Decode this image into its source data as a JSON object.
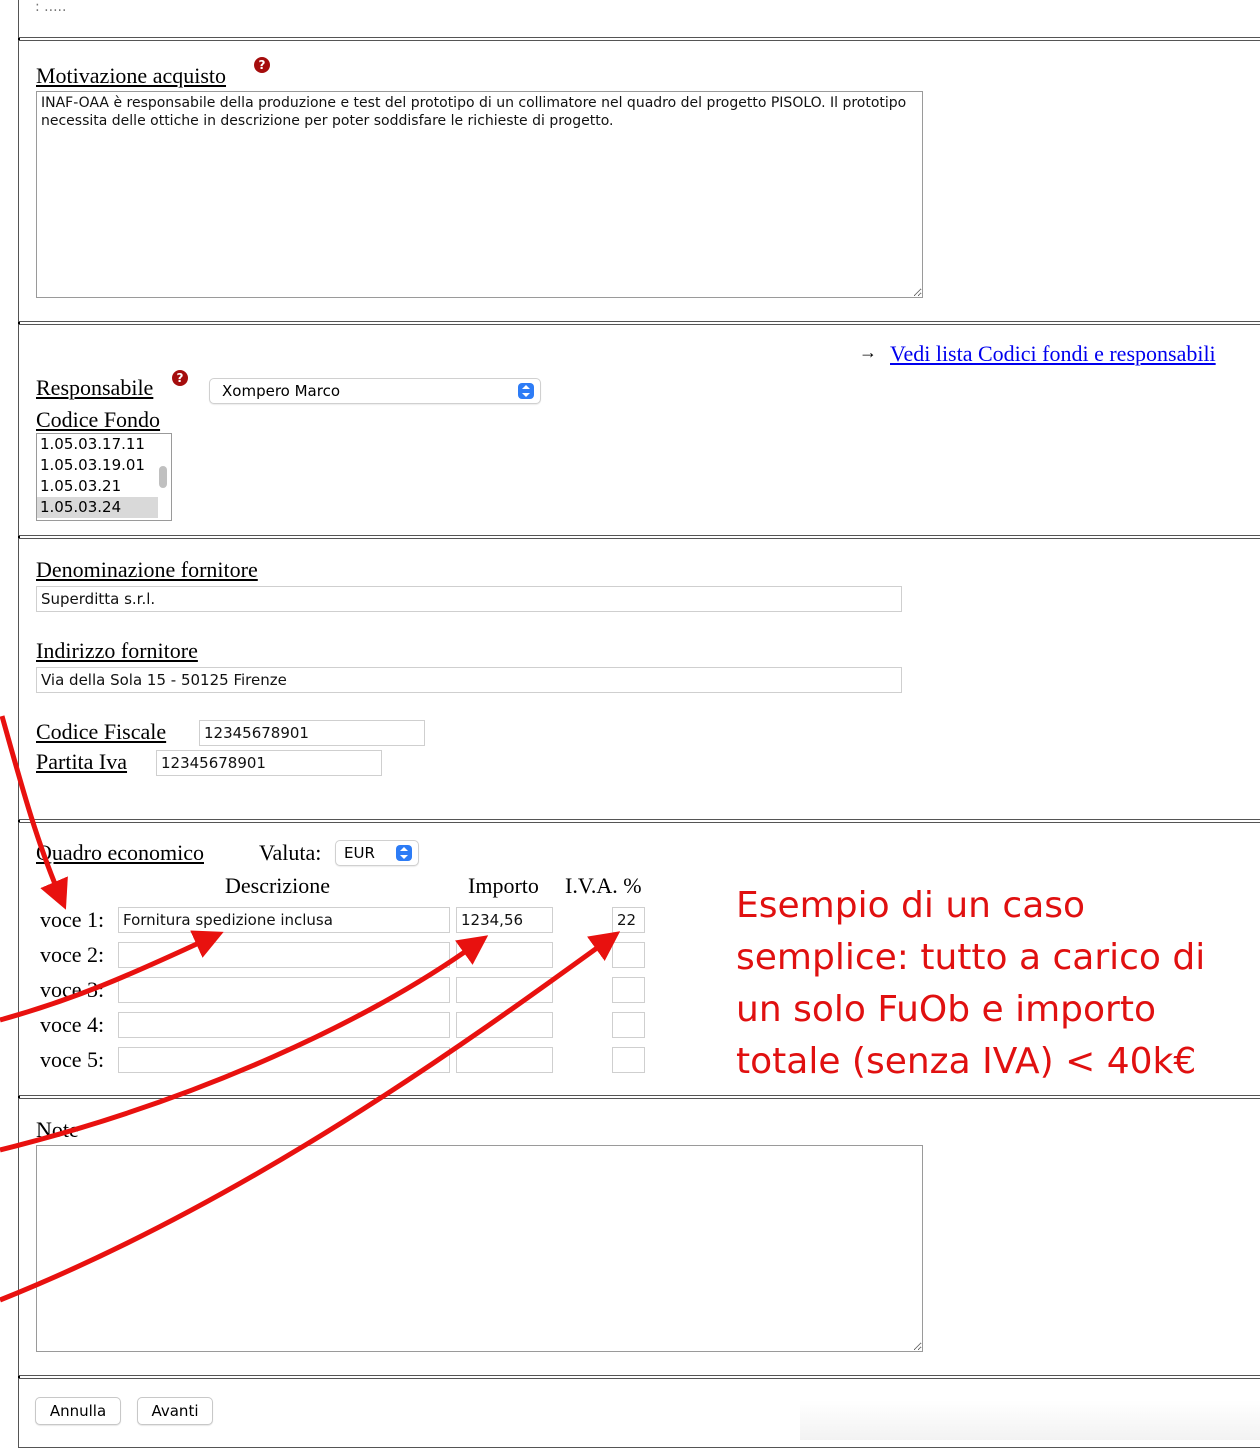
{
  "header_remnant": ": .....",
  "motivazione": {
    "label": "Motivazione acquisto",
    "help_icon": "?",
    "text": "INAF-OAA è responsabile della produzione e test del prototipo di un collimatore nel quadro del progetto PISOLO. Il prototipo necessita delle ottiche in descrizione per poter soddisfare le richieste di progetto."
  },
  "fondi": {
    "link_arrow": "→",
    "link_text": "Vedi lista Codici fondi e responsabili",
    "responsabile_label": "Responsabile",
    "responsabile_value": "Xompero Marco",
    "codice_fondo_label": "Codice Fondo",
    "codice_fondo_options": [
      "1.05.03.17.11",
      "1.05.03.19.01",
      "1.05.03.21",
      "1.05.03.24"
    ],
    "codice_fondo_selected": "1.05.03.24"
  },
  "fornitore": {
    "denominazione_label": "Denominazione fornitore",
    "denominazione_value": "Superditta s.r.l.",
    "indirizzo_label": "Indirizzo fornitore",
    "indirizzo_value": "Via della Sola 15 - 50125 Firenze",
    "codice_fiscale_label": "Codice Fiscale",
    "codice_fiscale_value": "12345678901",
    "partita_iva_label": "Partita Iva",
    "partita_iva_value": "12345678901"
  },
  "quadro": {
    "label": "Quadro economico",
    "valuta_label": "Valuta:",
    "valuta_value": "EUR",
    "col_descrizione": "Descrizione",
    "col_importo": "Importo",
    "col_iva": "I.V.A. %",
    "rows": [
      {
        "label": "voce 1:",
        "descrizione": "Fornitura spedizione inclusa",
        "importo": "1234,56",
        "iva": "22"
      },
      {
        "label": "voce 2:",
        "descrizione": "",
        "importo": "",
        "iva": ""
      },
      {
        "label": "voce 3:",
        "descrizione": "",
        "importo": "",
        "iva": ""
      },
      {
        "label": "voce 4:",
        "descrizione": "",
        "importo": "",
        "iva": ""
      },
      {
        "label": "voce 5:",
        "descrizione": "",
        "importo": "",
        "iva": ""
      }
    ]
  },
  "note": {
    "label": "Note",
    "text": ""
  },
  "buttons": {
    "annulla": "Annulla",
    "avanti": "Avanti"
  },
  "annotation": {
    "text": "Esempio di un caso semplice: tutto a carico di un solo FuOb e importo totale (senza IVA) < 40k€",
    "color": "#e01010"
  }
}
